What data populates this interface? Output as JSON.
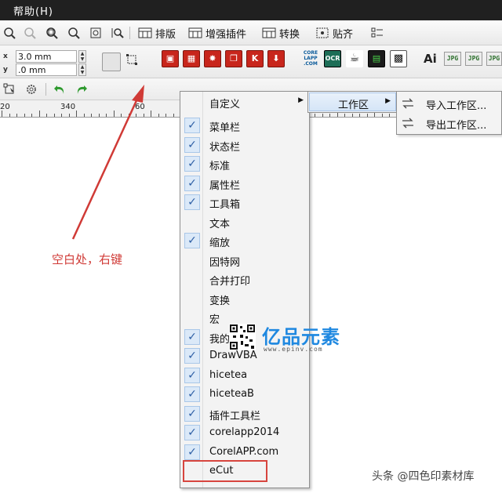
{
  "titlebar": {
    "menu_help": "帮助(H)"
  },
  "toolbar": {
    "layout_label": "排版",
    "enhance_label": "增强插件",
    "convert_label": "转换",
    "snap_label": "贴齐"
  },
  "property_bar": {
    "x_axis": "x",
    "y_axis": "y",
    "nudge_x": "3.0 mm",
    "nudge_y": ".0 mm",
    "jpg_button": "JPG",
    "ai_label": "Ai",
    "corel_app_logo": "CORELAPP.COM"
  },
  "ruler": {
    "tick_labels": [
      "20",
      "340",
      "60"
    ]
  },
  "annotation": {
    "text": "空白处，右键",
    "color": "#d03a36"
  },
  "context_menu": {
    "items": [
      {
        "label": "自定义",
        "checked": false,
        "submenu": true
      },
      {
        "label": "菜单栏",
        "checked": true
      },
      {
        "label": "状态栏",
        "checked": true
      },
      {
        "label": "标准",
        "checked": true
      },
      {
        "label": "属性栏",
        "checked": true
      },
      {
        "label": "工具箱",
        "checked": true
      },
      {
        "label": "文本",
        "checked": false
      },
      {
        "label": "缩放",
        "checked": true
      },
      {
        "label": "因特网",
        "checked": false
      },
      {
        "label": "合并打印",
        "checked": false
      },
      {
        "label": "变换",
        "checked": false
      },
      {
        "label": "宏",
        "checked": false
      },
      {
        "label": "我的",
        "checked": true
      },
      {
        "label": "DrawVBA",
        "checked": true
      },
      {
        "label": "hicetea",
        "checked": true
      },
      {
        "label": "hiceteaB",
        "checked": true
      },
      {
        "label": "插件工具栏",
        "checked": true
      },
      {
        "label": "corelapp2014",
        "checked": true
      },
      {
        "label": "CorelAPP.com",
        "checked": true
      },
      {
        "label": "eCut",
        "checked": false,
        "highlighted_box": true
      }
    ],
    "check_glyph": "✓"
  },
  "submenu_customize": {
    "label": "工作区"
  },
  "submenu_workspace": {
    "items": [
      {
        "label": "导入工作区..."
      },
      {
        "label": "导出工作区..."
      }
    ]
  },
  "watermarks": {
    "brand": "亿品元素",
    "url": "www.epinv.com",
    "source": "头条 @四色印素材库"
  },
  "colors": {
    "accent_red": "#d03a36",
    "menu_bg": "#f3f3f3",
    "titlebar_bg": "#202020"
  }
}
